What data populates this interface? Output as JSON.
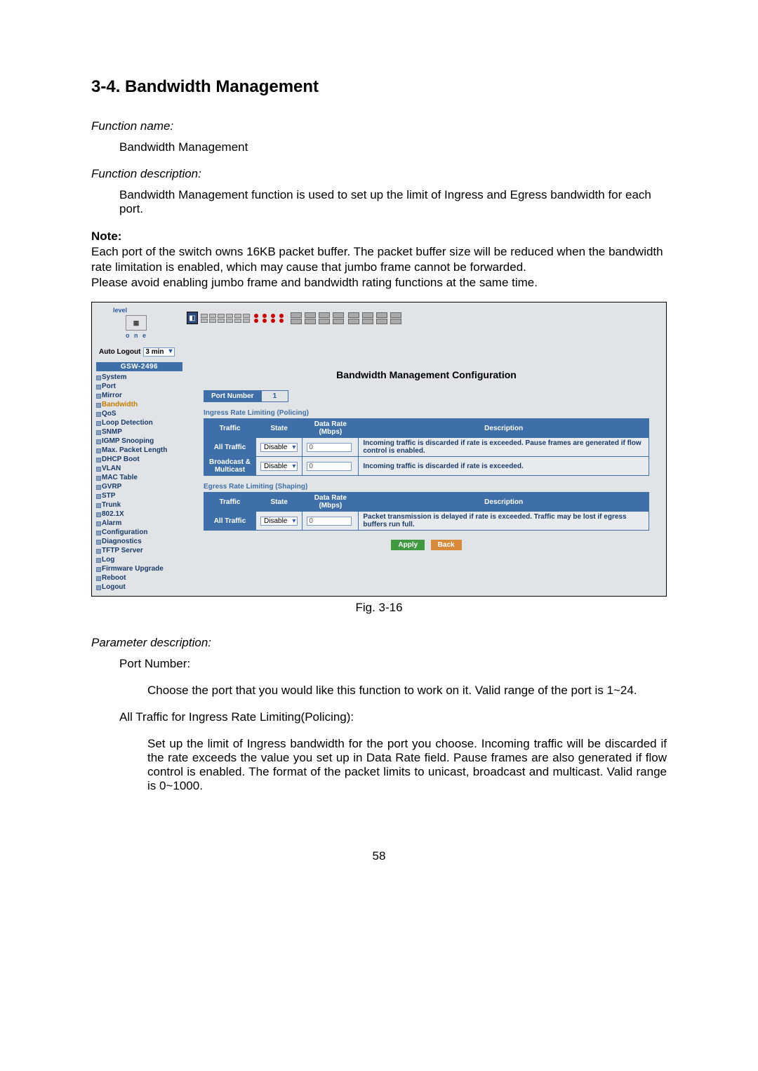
{
  "heading": "3-4. Bandwidth Management",
  "fn_label": "Function name:",
  "fn_value": "Bandwidth Management",
  "fd_label": "Function description:",
  "fd_value": "Bandwidth Management function is used to set up the limit of Ingress and Egress bandwidth for each port.",
  "note_label": "Note:",
  "note_p1": "Each port of the switch owns 16KB packet buffer. The packet buffer size will be reduced when the bandwidth rate limitation is enabled, which may cause that jumbo frame cannot be forwarded.",
  "note_p2": "Please avoid enabling jumbo frame and bandwidth rating functions at the same time.",
  "app": {
    "logo_brand": "level",
    "logo_one": "o n e",
    "auto_logout_label": "Auto Logout",
    "auto_logout_value": "3 min",
    "device": "GSW-2496",
    "sidebar": [
      "System",
      "Port",
      "Mirror",
      "Bandwidth",
      "QoS",
      "Loop Detection",
      "SNMP",
      "IGMP Snooping",
      "Max. Packet Length",
      "DHCP Boot",
      "VLAN",
      "MAC Table",
      "GVRP",
      "STP",
      "Trunk",
      "802.1X",
      "Alarm",
      "Configuration",
      "Diagnostics",
      "TFTP Server",
      "Log",
      "Firmware Upgrade",
      "Reboot",
      "Logout"
    ],
    "sidebar_active_index": 3,
    "page_title": "Bandwidth Management Configuration",
    "port_number_label": "Port Number",
    "port_number_value": "1",
    "ingress_title": "Ingress Rate Limiting (Policing)",
    "egress_title": "Egress Rate Limiting (Shaping)",
    "headers": {
      "traffic": "Traffic",
      "state": "State",
      "rate": "Data Rate (Mbps)",
      "desc": "Description"
    },
    "ingress_rows": [
      {
        "traffic": "All Traffic",
        "state": "Disable",
        "rate": "0",
        "desc": "Incoming traffic is discarded if rate is exceeded. Pause frames are generated if flow control is enabled."
      },
      {
        "traffic": "Broadcast & Multicast",
        "state": "Disable",
        "rate": "0",
        "desc": "Incoming traffic is discarded if rate is exceeded."
      }
    ],
    "egress_rows": [
      {
        "traffic": "All Traffic",
        "state": "Disable",
        "rate": "0",
        "desc": "Packet transmission is delayed if rate is exceeded. Traffic may be lost if egress buffers run full."
      }
    ],
    "apply": "Apply",
    "back": "Back"
  },
  "figcap": "Fig. 3-16",
  "pd_label": "Parameter description:",
  "param1_title": "Port Number:",
  "param1_body": "Choose the port that you would like this function to work on it. Valid range of the port is 1~24.",
  "param2_title": "All Traffic for Ingress Rate Limiting(Policing):",
  "param2_body": "Set up the limit of Ingress bandwidth for the port you choose.  Incoming traffic will be discarded if the rate exceeds the value you set up in Data Rate field. Pause frames are also generated if flow control is enabled. The format of the packet limits to unicast, broadcast and multicast. Valid range is 0~1000.",
  "page_number": "58"
}
